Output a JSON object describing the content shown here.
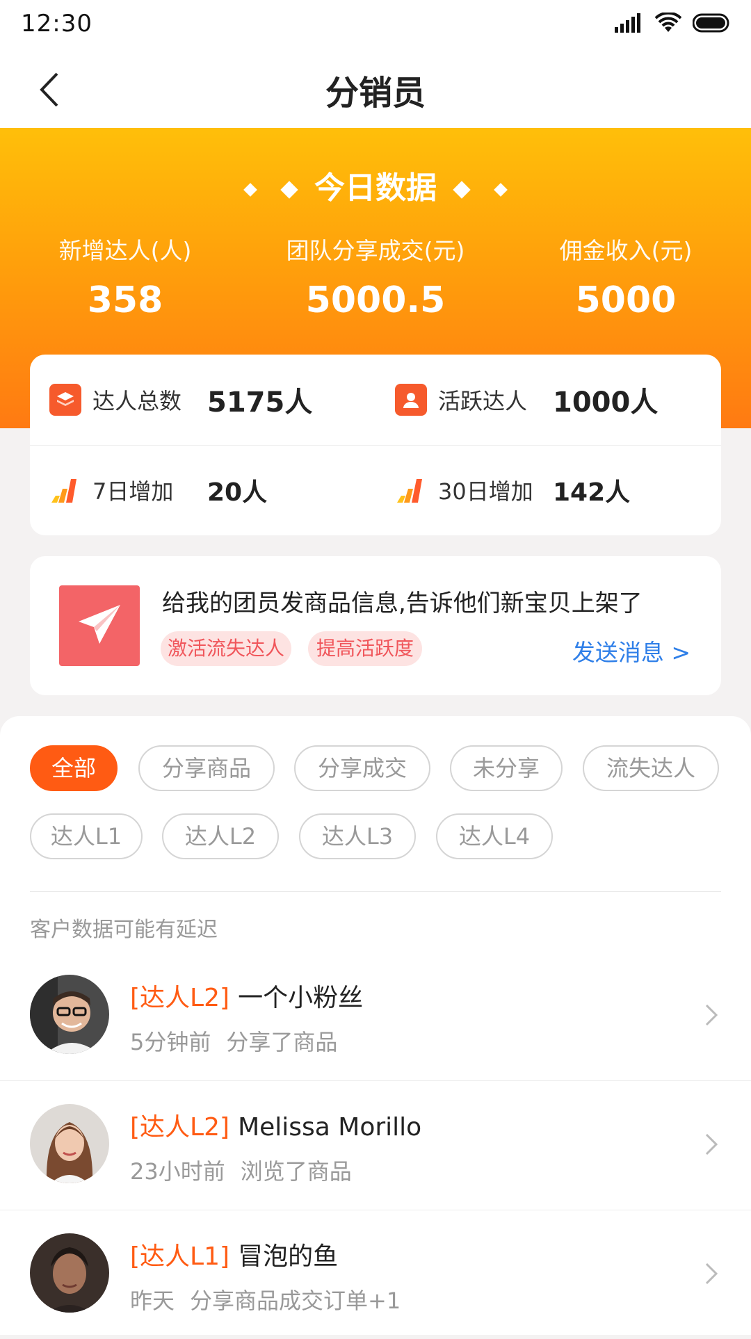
{
  "status": {
    "time": "12:30"
  },
  "header": {
    "title": "分销员"
  },
  "today": {
    "title": "今日数据",
    "stats": [
      {
        "label": "新增达人(人)",
        "value": "358"
      },
      {
        "label": "团队分享成交(元)",
        "value": "5000.5"
      },
      {
        "label": "佣金收入(元)",
        "value": "5000"
      }
    ]
  },
  "summary": [
    {
      "label": "达人总数",
      "value": "5175人",
      "icon": "layers-icon"
    },
    {
      "label": "活跃达人",
      "value": "1000人",
      "icon": "user-icon"
    },
    {
      "label": "7日增加",
      "value": "20人",
      "icon": "bar-growth-icon"
    },
    {
      "label": "30日增加",
      "value": "142人",
      "icon": "bar-growth-icon"
    }
  ],
  "message": {
    "text": "给我的团员发商品信息,告诉他们新宝贝上架了",
    "tags": [
      "激活流失达人",
      "提高活跃度"
    ],
    "send": "发送消息 >"
  },
  "filters": {
    "row1": [
      "全部",
      "分享商品",
      "分享成交",
      "未分享",
      "流失达人"
    ],
    "row2": [
      "达人L1",
      "达人L2",
      "达人L3",
      "达人L4"
    ],
    "active": "全部"
  },
  "notice": "客户数据可能有延迟",
  "members": [
    {
      "level": "[达人L2]",
      "name": "一个小粉丝",
      "time": "5分钟前",
      "action": "分享了商品"
    },
    {
      "level": "[达人L2]",
      "name": "Melissa Morillo",
      "time": "23小时前",
      "action": "浏览了商品"
    },
    {
      "level": "[达人L1]",
      "name": "冒泡的鱼",
      "time": "昨天",
      "action": "分享商品成交订单+1"
    }
  ],
  "colors": {
    "accent": "#ff5b13",
    "link": "#2f7fe8",
    "tag_bg": "#fde3e2",
    "tag_text": "#f0565b"
  }
}
